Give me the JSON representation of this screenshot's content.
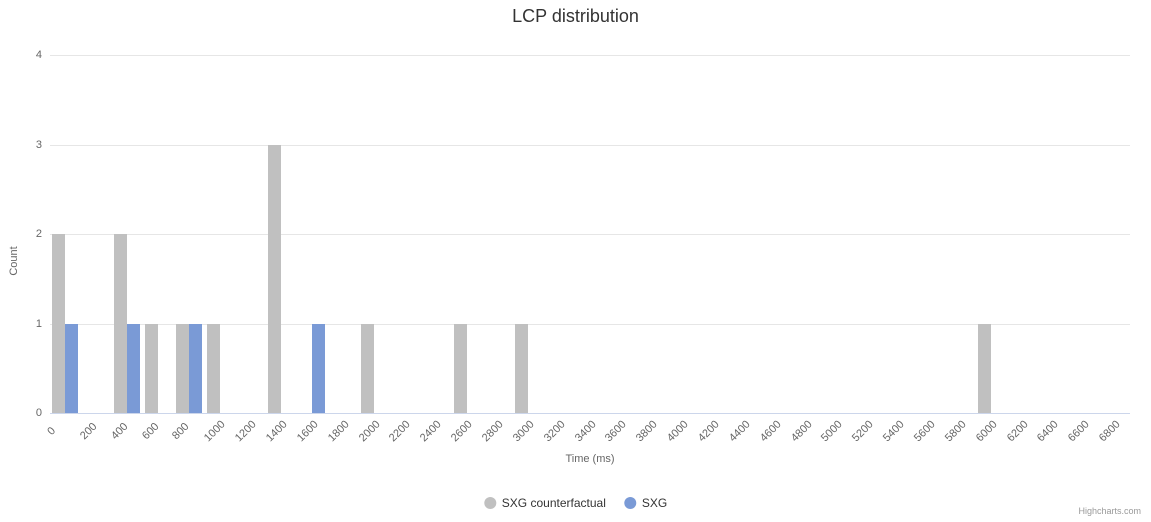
{
  "chart_data": {
    "type": "bar",
    "title": "LCP distribution",
    "xlabel": "Time (ms)",
    "ylabel": "Count",
    "ylim": [
      0,
      4
    ],
    "y_ticks": [
      0,
      1,
      2,
      3,
      4
    ],
    "categories": [
      "0",
      "200",
      "400",
      "600",
      "800",
      "1000",
      "1200",
      "1400",
      "1600",
      "1800",
      "2000",
      "2200",
      "2400",
      "2600",
      "2800",
      "3000",
      "3200",
      "3400",
      "3600",
      "3800",
      "4000",
      "4200",
      "4400",
      "4600",
      "4800",
      "5000",
      "5200",
      "5400",
      "5600",
      "5800",
      "6000",
      "6200",
      "6400",
      "6600",
      "6800"
    ],
    "series": [
      {
        "name": "SXG counterfactual",
        "color": "#c0c0c0",
        "values": [
          2,
          0,
          2,
          1,
          1,
          1,
          0,
          3,
          0,
          0,
          1,
          0,
          0,
          1,
          0,
          1,
          0,
          0,
          0,
          0,
          0,
          0,
          0,
          0,
          0,
          0,
          0,
          0,
          0,
          0,
          1,
          0,
          0,
          0,
          0
        ]
      },
      {
        "name": "SXG",
        "color": "#7a9ad6",
        "values": [
          1,
          0,
          1,
          0,
          1,
          0,
          0,
          0,
          1,
          0,
          0,
          0,
          0,
          0,
          0,
          0,
          0,
          0,
          0,
          0,
          0,
          0,
          0,
          0,
          0,
          0,
          0,
          0,
          0,
          0,
          0,
          0,
          0,
          0,
          0
        ]
      }
    ],
    "credits": "Highcharts.com"
  }
}
